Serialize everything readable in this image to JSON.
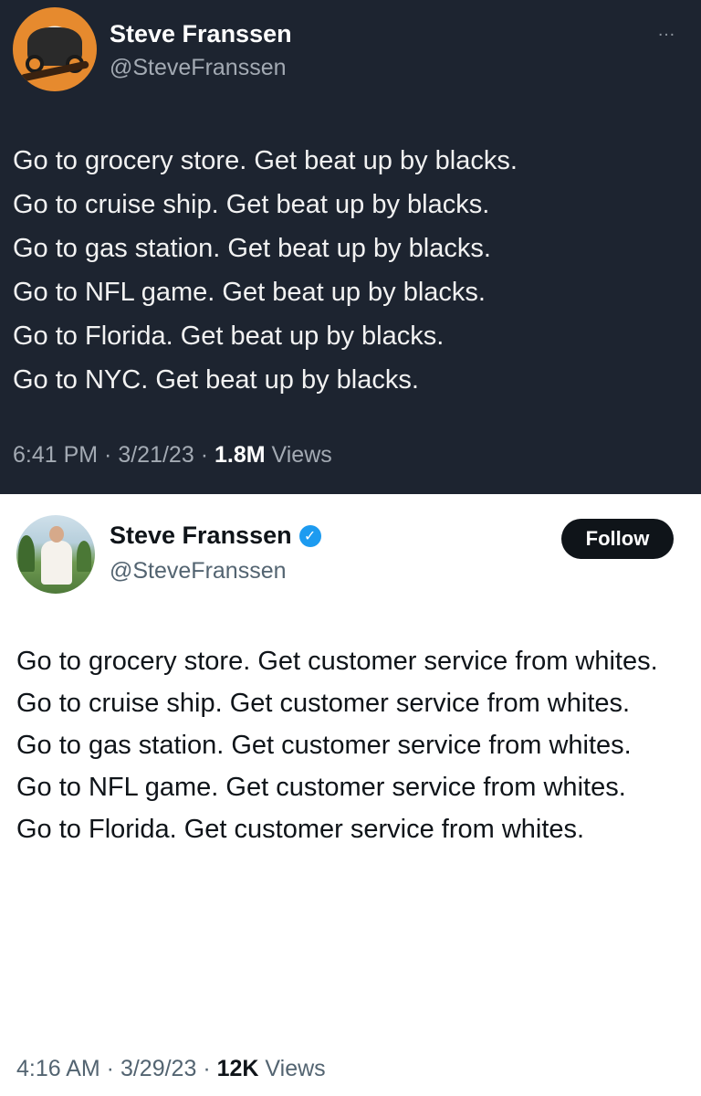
{
  "tweet_top": {
    "theme": "dark",
    "author": {
      "name": "Steve Franssen",
      "handle": "@SteveFranssen",
      "avatar": "orange-circle-car-logo"
    },
    "more_menu": "…",
    "lines": [
      "Go to grocery store. Get beat up by blacks.",
      "Go to cruise ship. Get beat up by blacks.",
      "Go to gas station. Get beat up by blacks.",
      "Go to NFL game. Get beat up by blacks.",
      "Go to Florida. Get beat up by blacks.",
      "Go to NYC. Get beat up by blacks."
    ],
    "time": "6:41 PM",
    "date": "3/21/23",
    "separator": " · ",
    "views_count": "1.8M",
    "views_label": "Views"
  },
  "tweet_bottom": {
    "theme": "light",
    "author": {
      "name": "Steve Franssen",
      "handle": "@SteveFranssen",
      "verified": true,
      "avatar": "man-in-white-outfit-on-golf-course"
    },
    "follow_label": "Follow",
    "lines": [
      "Go to grocery store. Get customer service from whites.",
      "Go to cruise ship. Get customer service from whites.",
      "Go to gas station. Get customer service from whites.",
      "Go to NFL game. Get customer service from whites.",
      "Go to Florida. Get customer service from whites."
    ],
    "time": "4:16 AM",
    "date": "3/29/23",
    "separator": " · ",
    "views_count": "12K",
    "views_label": "Views"
  },
  "colors": {
    "dark_bg": "#1d2430",
    "verified_blue": "#1d9bf0",
    "light_secondary_text": "#536471"
  }
}
